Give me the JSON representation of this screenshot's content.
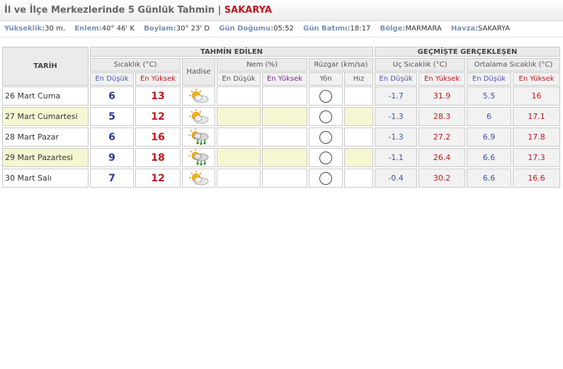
{
  "page": {
    "title": "İl ve İlçe Merkezlerinde 5 Günlük Tahmin",
    "separator": "|",
    "city": "SAKARYA"
  },
  "info": [
    {
      "key": "Yükseklik:",
      "value": "30 m."
    },
    {
      "key": "Enlem:",
      "value": "40° 46' K"
    },
    {
      "key": "Boylam:",
      "value": "30° 23' D"
    },
    {
      "key": "Gün Doğumu:",
      "value": "05:52"
    },
    {
      "key": "Gün Batımı:",
      "value": "18:17"
    },
    {
      "key": "Bölge:",
      "value": "MARMARA"
    },
    {
      "key": "Havza:",
      "value": "SAKARYA"
    }
  ],
  "table": {
    "tarih": "TARİH",
    "tahmin_edilen": "TAHMİN EDİLEN",
    "gecmiste": "GEÇMİŞTE GERÇEKLEŞEN",
    "sicaklik": "Sıcaklık (°C)",
    "hadise": "Hadise",
    "nem": "Nem (%)",
    "ruzgar": "Rüzgar (km/sa)",
    "uc_sicaklik": "Uç Sıcaklık (°C)",
    "ortalama_sicaklik": "Ortalama Sıcaklık (°C)",
    "en_dusuk": "En Düşük",
    "en_yuksek": "En Yüksek",
    "yon": "Yön",
    "hiz": "Hız"
  },
  "rows": [
    {
      "date": "26 Mart Cuma",
      "min": "6",
      "max": "13",
      "icon": "partly-cloudy-sun-icon",
      "nem_min": "",
      "nem_max": "",
      "hiz": "",
      "uc_min": "-1.7",
      "uc_max": "31.9",
      "ort_min": "5.5",
      "ort_max": "16"
    },
    {
      "date": "27 Mart Cumartesi",
      "min": "5",
      "max": "12",
      "icon": "partly-cloudy-sun-icon",
      "nem_min": "",
      "nem_max": "",
      "hiz": "",
      "uc_min": "-1.3",
      "uc_max": "28.3",
      "ort_min": "6",
      "ort_max": "17.1"
    },
    {
      "date": "28 Mart Pazar",
      "min": "6",
      "max": "16",
      "icon": "sun-cloud-rain-icon",
      "nem_min": "",
      "nem_max": "",
      "hiz": "",
      "uc_min": "-1.3",
      "uc_max": "27.2",
      "ort_min": "6.9",
      "ort_max": "17.8"
    },
    {
      "date": "29 Mart Pazartesi",
      "min": "9",
      "max": "18",
      "icon": "sun-cloud-rain-icon",
      "nem_min": "",
      "nem_max": "",
      "hiz": "",
      "uc_min": "-1.1",
      "uc_max": "26.4",
      "ort_min": "6.6",
      "ort_max": "17.3"
    },
    {
      "date": "30 Mart Salı",
      "min": "7",
      "max": "12",
      "icon": "partly-cloudy-sun-icon",
      "nem_min": "",
      "nem_max": "",
      "hiz": "",
      "uc_min": "-0.4",
      "uc_max": "30.2",
      "ort_min": "6.6",
      "ort_max": "16.6"
    }
  ],
  "colors": {
    "accent_red": "#c0171d",
    "accent_blue": "#4a55b5",
    "row_highlight": "#f6f6d2"
  }
}
